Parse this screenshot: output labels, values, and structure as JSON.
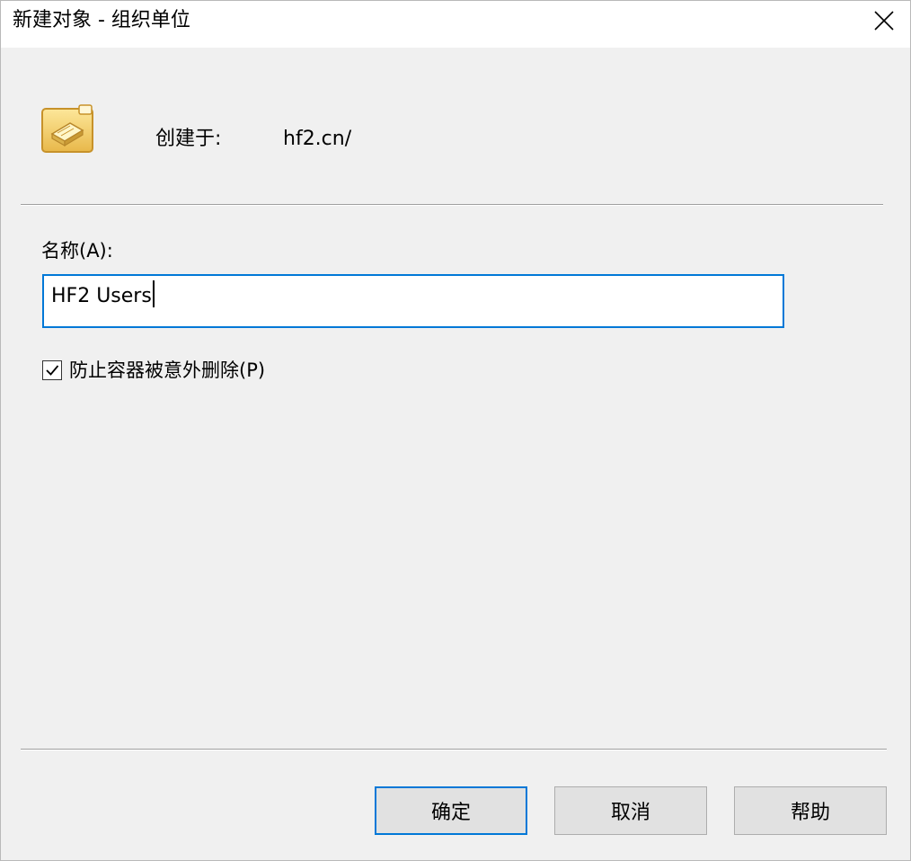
{
  "window": {
    "title": "新建对象 - 组织单位"
  },
  "header": {
    "icon": "organizational-unit-folder-icon",
    "created_in_label": "创建于:",
    "created_in_value": "hf2.cn/"
  },
  "form": {
    "name_label": "名称(A):",
    "name_value": "HF2 Users",
    "protect_checkbox": {
      "label": "防止容器被意外删除(P)",
      "checked": true
    }
  },
  "buttons": {
    "ok": "确定",
    "cancel": "取消",
    "help": "帮助"
  },
  "colors": {
    "accent": "#0078d7",
    "dialog_bg": "#f0f0f0",
    "button_bg": "#e1e1e1"
  }
}
